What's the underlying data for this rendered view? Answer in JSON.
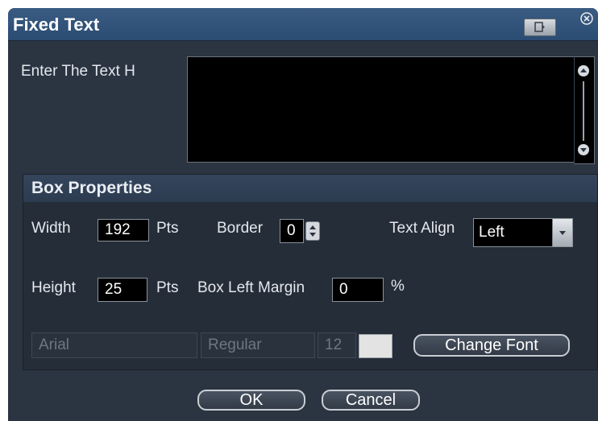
{
  "dialog": {
    "title": "Fixed Text",
    "prompt_label": "Enter The Text H",
    "text_value": ""
  },
  "box_properties": {
    "title": "Box Properties",
    "width_label": "Width",
    "width_value": "192",
    "width_unit": "Pts",
    "border_label": "Border",
    "border_value": "0",
    "text_align_label": "Text Align",
    "text_align_value": "Left",
    "height_label": "Height",
    "height_value": "25",
    "height_unit": "Pts",
    "left_margin_label": "Box Left Margin",
    "left_margin_value": "0",
    "left_margin_unit": "%",
    "font_family": "Arial",
    "font_style": "Regular",
    "font_size": "12",
    "font_color": "#e3e3e3",
    "change_font_label": "Change Font"
  },
  "actions": {
    "ok_label": "OK",
    "cancel_label": "Cancel"
  },
  "icons": {
    "title_button": "window-restore-icon",
    "close": "close-icon",
    "scroll_up": "scroll-up-icon",
    "scroll_down": "scroll-down-icon",
    "spinner": "spinner-icon",
    "dropdown": "chevron-down-icon"
  }
}
